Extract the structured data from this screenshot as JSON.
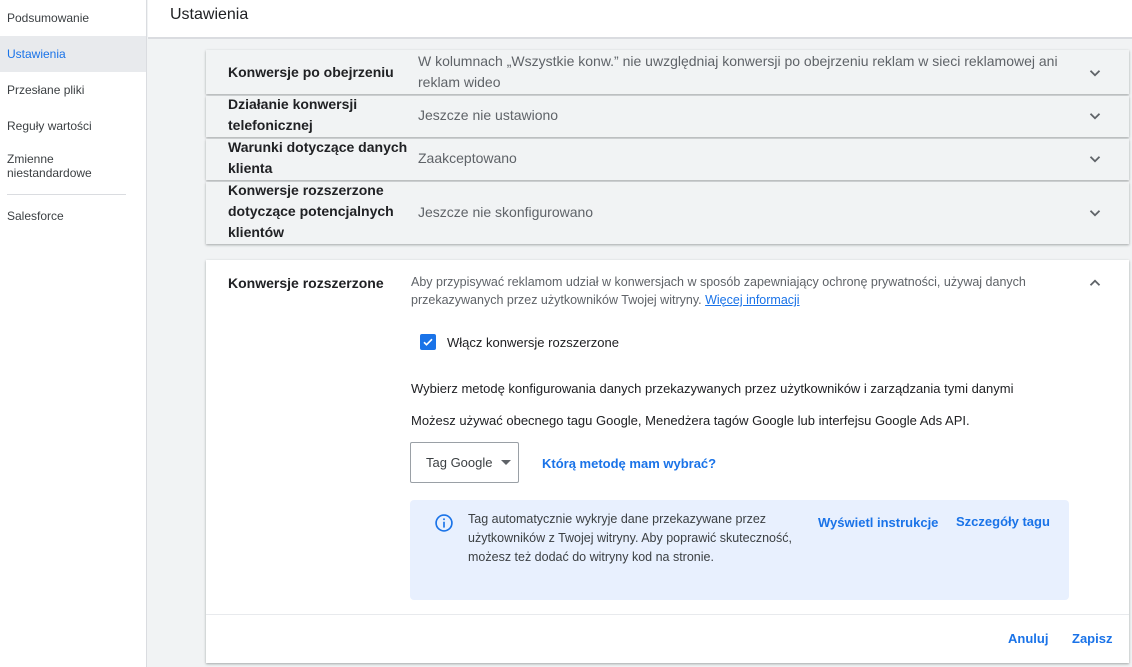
{
  "sidebar": {
    "items": [
      {
        "label": "Podsumowanie"
      },
      {
        "label": "Ustawienia"
      },
      {
        "label": "Przesłane pliki"
      },
      {
        "label": "Reguły wartości"
      },
      {
        "label": "Zmienne niestandardowe"
      },
      {
        "label": "Salesforce"
      }
    ],
    "active_index": 1
  },
  "header": {
    "title": "Ustawienia"
  },
  "cards": [
    {
      "label": "Konwersje po obejrzeniu",
      "value": "W kolumnach „Wszystkie konw.” nie uwzględniaj konwersji po obejrzeniu reklam w sieci reklamowej ani reklam wideo"
    },
    {
      "label": "Działanie konwersji telefonicznej",
      "value": "Jeszcze nie ustawiono"
    },
    {
      "label": "Warunki dotyczące danych klienta",
      "value": "Zaakceptowano"
    },
    {
      "label": "Konwersje rozszerzone dotyczące potencjalnych klientów",
      "value": "Jeszcze nie skonfigurowano"
    }
  ],
  "expanded": {
    "label": "Konwersje rozszerzone",
    "description": "Aby przypisywać reklamom udział w konwersjach w sposób zapewniający ochronę prywatności, używaj danych przekazywanych przez użytkowników Twojej witryny.",
    "learn_more": "Więcej informacji",
    "checkbox_label": "Włącz konwersje rozszerzone",
    "checkbox_checked": true,
    "method_heading": "Wybierz metodę konfigurowania danych przekazywanych przez użytkowników i zarządzania tymi danymi",
    "method_sub": "Możesz używać obecnego tagu Google, Menedżera tagów Google lub interfejsu Google Ads API.",
    "select_value": "Tag Google",
    "which_method": "Którą metodę mam wybrać?",
    "info_text": "Tag automatycznie wykryje dane przekazywane przez użytkowników z Twojej witryny. Aby poprawić skuteczność, możesz też dodać do witryny kod na stronie.",
    "view_instructions": "Wyświetl instrukcje",
    "tag_details": "Szczegóły tagu",
    "cancel": "Anuluj",
    "save": "Zapisz"
  },
  "colors": {
    "accent": "#1a73e8",
    "info_bg": "#e8f0fe"
  }
}
